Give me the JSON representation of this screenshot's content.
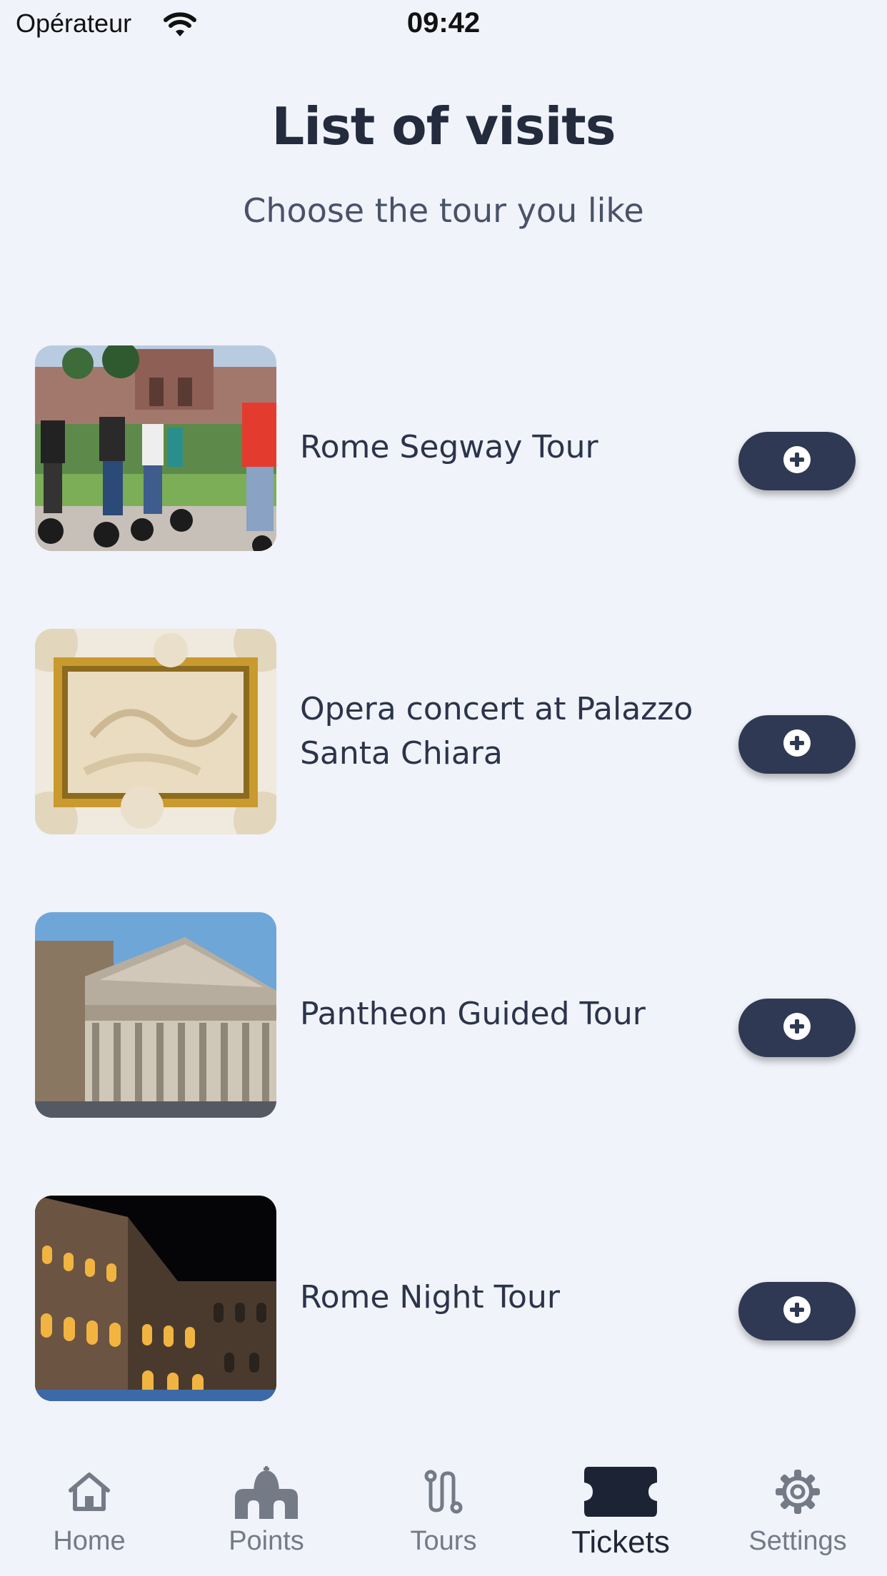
{
  "status_bar": {
    "carrier": "Opérateur",
    "time": "09:42",
    "wifi_icon": "wifi-icon"
  },
  "header": {
    "title": "List of visits",
    "subtitle": "Choose the tour you like"
  },
  "visits": [
    {
      "name": "Rome Segway Tour",
      "image": "segway-tour-photo",
      "add_icon": "plus-circle-icon"
    },
    {
      "name": "Opera concert at Palazzo Santa Chiara",
      "image": "palazzo-ceiling-photo",
      "add_icon": "plus-circle-icon"
    },
    {
      "name": "Pantheon Guided Tour",
      "image": "pantheon-photo",
      "add_icon": "plus-circle-icon"
    },
    {
      "name": "Rome Night Tour",
      "image": "colosseum-night-photo",
      "add_icon": "plus-circle-icon"
    }
  ],
  "tab_bar": {
    "active": "Tickets",
    "tabs": [
      {
        "label": "Home",
        "icon": "home-icon"
      },
      {
        "label": "Points",
        "icon": "church-icon"
      },
      {
        "label": "Tours",
        "icon": "route-icon"
      },
      {
        "label": "Tickets",
        "icon": "ticket-icon"
      },
      {
        "label": "Settings",
        "icon": "gear-icon"
      }
    ]
  },
  "colors": {
    "background": "#f0f3f9",
    "button": "#2f3953",
    "title": "#232b3d",
    "inactive_tab": "#747a86"
  }
}
